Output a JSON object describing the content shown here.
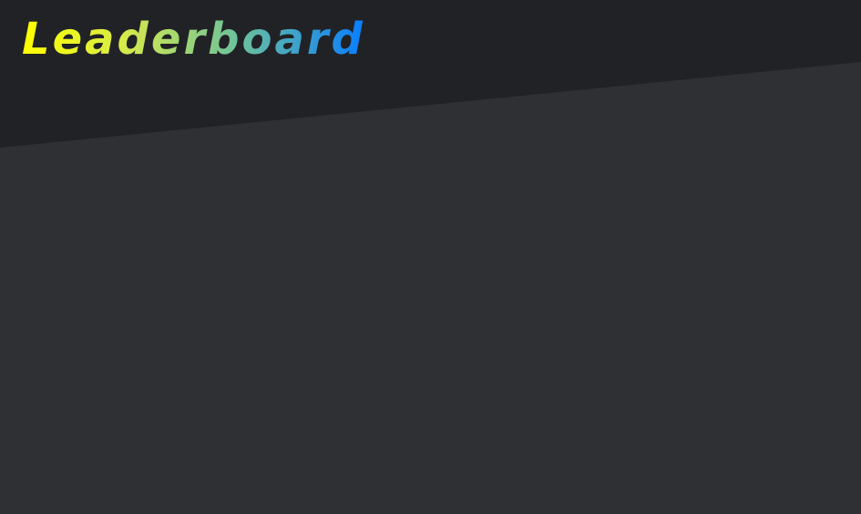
{
  "header": {
    "title": "Leaderboard"
  },
  "colors": {
    "header_background": "#212226",
    "content_background": "#2f3034",
    "title_gradient_start": "#ffff00",
    "title_gradient_end": "#087dff"
  }
}
